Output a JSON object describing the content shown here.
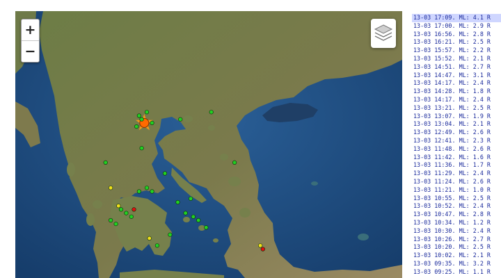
{
  "map": {
    "zoom_in_label": "+",
    "zoom_out_label": "−",
    "layers_icon": "layers-stack-icon",
    "colors": {
      "sea": "#1f4f86",
      "land": "#6f7c48",
      "quake_recent": "#ff6a00",
      "quake_day": "#e01010",
      "quake_minor": "#f2e21a",
      "quake_old": "#22d022"
    },
    "markers": [
      {
        "lat": 40.1,
        "lon": 22.0,
        "level": "major"
      },
      {
        "lat": 40.3,
        "lon": 21.8,
        "level": "old"
      },
      {
        "lat": 40.2,
        "lon": 21.9,
        "level": "old"
      },
      {
        "lat": 40.4,
        "lon": 22.1,
        "level": "old"
      },
      {
        "lat": 40.1,
        "lon": 22.3,
        "level": "old"
      },
      {
        "lat": 40.0,
        "lon": 21.7,
        "level": "old"
      },
      {
        "lat": 40.2,
        "lon": 23.4,
        "level": "old"
      },
      {
        "lat": 39.4,
        "lon": 21.9,
        "level": "old"
      },
      {
        "lat": 39.0,
        "lon": 20.5,
        "level": "old"
      },
      {
        "lat": 38.7,
        "lon": 22.8,
        "level": "old"
      },
      {
        "lat": 38.2,
        "lon": 21.8,
        "level": "old"
      },
      {
        "lat": 38.3,
        "lon": 22.1,
        "level": "old"
      },
      {
        "lat": 38.2,
        "lon": 22.3,
        "level": "old"
      },
      {
        "lat": 37.9,
        "lon": 23.3,
        "level": "old"
      },
      {
        "lat": 38.0,
        "lon": 23.8,
        "level": "old"
      },
      {
        "lat": 37.6,
        "lon": 23.6,
        "level": "old"
      },
      {
        "lat": 37.5,
        "lon": 23.9,
        "level": "old"
      },
      {
        "lat": 37.4,
        "lon": 24.1,
        "level": "old"
      },
      {
        "lat": 37.2,
        "lon": 24.4,
        "level": "old"
      },
      {
        "lat": 37.4,
        "lon": 20.7,
        "level": "old"
      },
      {
        "lat": 37.3,
        "lon": 20.9,
        "level": "old"
      },
      {
        "lat": 37.7,
        "lon": 21.1,
        "level": "old"
      },
      {
        "lat": 37.5,
        "lon": 21.5,
        "level": "old"
      },
      {
        "lat": 37.6,
        "lon": 21.3,
        "level": "old"
      },
      {
        "lat": 37.0,
        "lon": 23.0,
        "level": "old"
      },
      {
        "lat": 39.0,
        "lon": 25.5,
        "level": "old"
      },
      {
        "lat": 40.4,
        "lon": 24.6,
        "level": "old"
      },
      {
        "lat": 36.7,
        "lon": 22.5,
        "level": "old"
      },
      {
        "lat": 38.3,
        "lon": 20.7,
        "level": "minor"
      },
      {
        "lat": 37.8,
        "lon": 21.0,
        "level": "minor"
      },
      {
        "lat": 36.9,
        "lon": 22.2,
        "level": "minor"
      },
      {
        "lat": 36.7,
        "lon": 26.5,
        "level": "minor"
      },
      {
        "lat": 37.7,
        "lon": 21.6,
        "level": "day"
      },
      {
        "lat": 36.6,
        "lon": 26.6,
        "level": "day"
      }
    ]
  },
  "events": [
    {
      "time": "13-03 17:09.",
      "mag": "ML: 4.1 R"
    },
    {
      "time": "13-03 17:00.",
      "mag": "ML: 2.9 R"
    },
    {
      "time": "13-03 16:56.",
      "mag": "ML: 2.8 R"
    },
    {
      "time": "13-03 16:21.",
      "mag": "ML: 2.5 R"
    },
    {
      "time": "13-03 15:57.",
      "mag": "ML: 2.2 R"
    },
    {
      "time": "13-03 15:52.",
      "mag": "ML: 2.1 R"
    },
    {
      "time": "13-03 14:51.",
      "mag": "ML: 2.7 R"
    },
    {
      "time": "13-03 14:47.",
      "mag": "ML: 3.1 R"
    },
    {
      "time": "13-03 14:17.",
      "mag": "ML: 2.4 R"
    },
    {
      "time": "13-03 14:28.",
      "mag": "ML: 1.8 R"
    },
    {
      "time": "13-03 14:17.",
      "mag": "ML: 2.4 R"
    },
    {
      "time": "13-03 13:21.",
      "mag": "ML: 2.5 R"
    },
    {
      "time": "13-03 13:07.",
      "mag": "ML: 1.9 R"
    },
    {
      "time": "13-03 13:04.",
      "mag": "ML: 2.1 R"
    },
    {
      "time": "13-03 12:49.",
      "mag": "ML: 2.6 R"
    },
    {
      "time": "13-03 12:41.",
      "mag": "ML: 2.3 R"
    },
    {
      "time": "13-03 11:48.",
      "mag": "ML: 2.6 R"
    },
    {
      "time": "13-03 11:42.",
      "mag": "ML: 1.6 R"
    },
    {
      "time": "13-03 11:36.",
      "mag": "ML: 1.7 R"
    },
    {
      "time": "13-03 11:29.",
      "mag": "ML: 2.4 R"
    },
    {
      "time": "13-03 11:24.",
      "mag": "ML: 2.6 R"
    },
    {
      "time": "13-03 11:21.",
      "mag": "ML: 1.0 R"
    },
    {
      "time": "13-03 10:55.",
      "mag": "ML: 2.5 R"
    },
    {
      "time": "13-03 10:52.",
      "mag": "ML: 2.4 R"
    },
    {
      "time": "13-03 10:47.",
      "mag": "ML: 2.8 R"
    },
    {
      "time": "13-03 10:34.",
      "mag": "ML: 1.2 R"
    },
    {
      "time": "13-03 10:30.",
      "mag": "ML: 2.4 R"
    },
    {
      "time": "13-03 10:26.",
      "mag": "ML: 2.7 R"
    },
    {
      "time": "13-03 10:20.",
      "mag": "ML: 2.5 R"
    },
    {
      "time": "13-03 10:02.",
      "mag": "ML: 2.1 R"
    },
    {
      "time": "13-03 09:35.",
      "mag": "ML: 3.2 R"
    },
    {
      "time": "13-03 09:25.",
      "mag": "ML: 1.1 R"
    }
  ]
}
